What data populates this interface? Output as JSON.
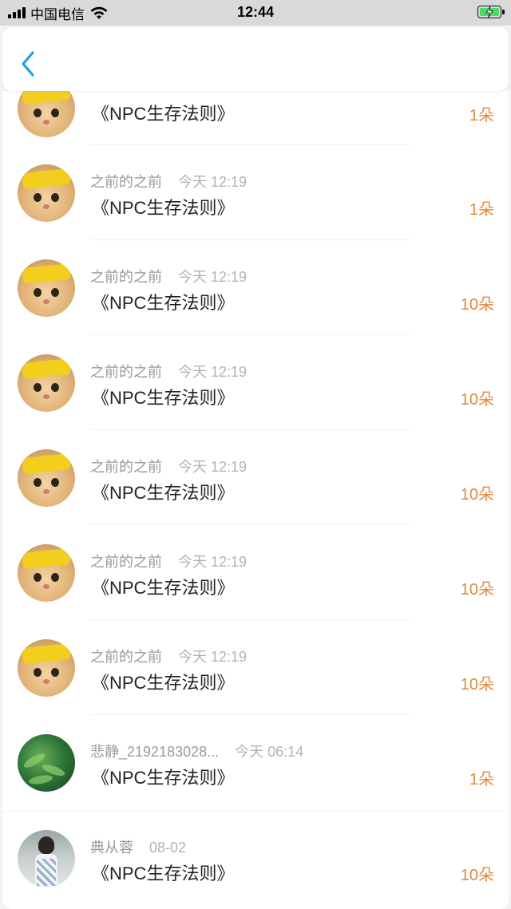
{
  "status_bar": {
    "carrier": "中国电信",
    "time": "12:44",
    "icons": [
      "signal-icon",
      "wifi-icon",
      "battery-charging-icon"
    ]
  },
  "nav": {
    "back_icon": "chevron-left-icon"
  },
  "accent_color": "#e08a3c",
  "nav_accent_color": "#1da1e6",
  "rows": [
    {
      "name": "",
      "time": "",
      "title": "《NPC生存法则》",
      "amount": "1朵",
      "avatar": "cat"
    },
    {
      "name": "之前的之前",
      "time": "今天 12:19",
      "title": "《NPC生存法则》",
      "amount": "1朵",
      "avatar": "cat"
    },
    {
      "name": "之前的之前",
      "time": "今天 12:19",
      "title": "《NPC生存法则》",
      "amount": "10朵",
      "avatar": "cat"
    },
    {
      "name": "之前的之前",
      "time": "今天 12:19",
      "title": "《NPC生存法则》",
      "amount": "10朵",
      "avatar": "cat"
    },
    {
      "name": "之前的之前",
      "time": "今天 12:19",
      "title": "《NPC生存法则》",
      "amount": "10朵",
      "avatar": "cat"
    },
    {
      "name": "之前的之前",
      "time": "今天 12:19",
      "title": "《NPC生存法则》",
      "amount": "10朵",
      "avatar": "cat"
    },
    {
      "name": "之前的之前",
      "time": "今天 12:19",
      "title": "《NPC生存法则》",
      "amount": "10朵",
      "avatar": "cat"
    },
    {
      "name": "悲静_2192183028...",
      "time": "今天 06:14",
      "title": "《NPC生存法则》",
      "amount": "1朵",
      "avatar": "green"
    },
    {
      "name": "典从蓉",
      "time": "08-02",
      "title": "《NPC生存法则》",
      "amount": "10朵",
      "avatar": "lady"
    }
  ]
}
